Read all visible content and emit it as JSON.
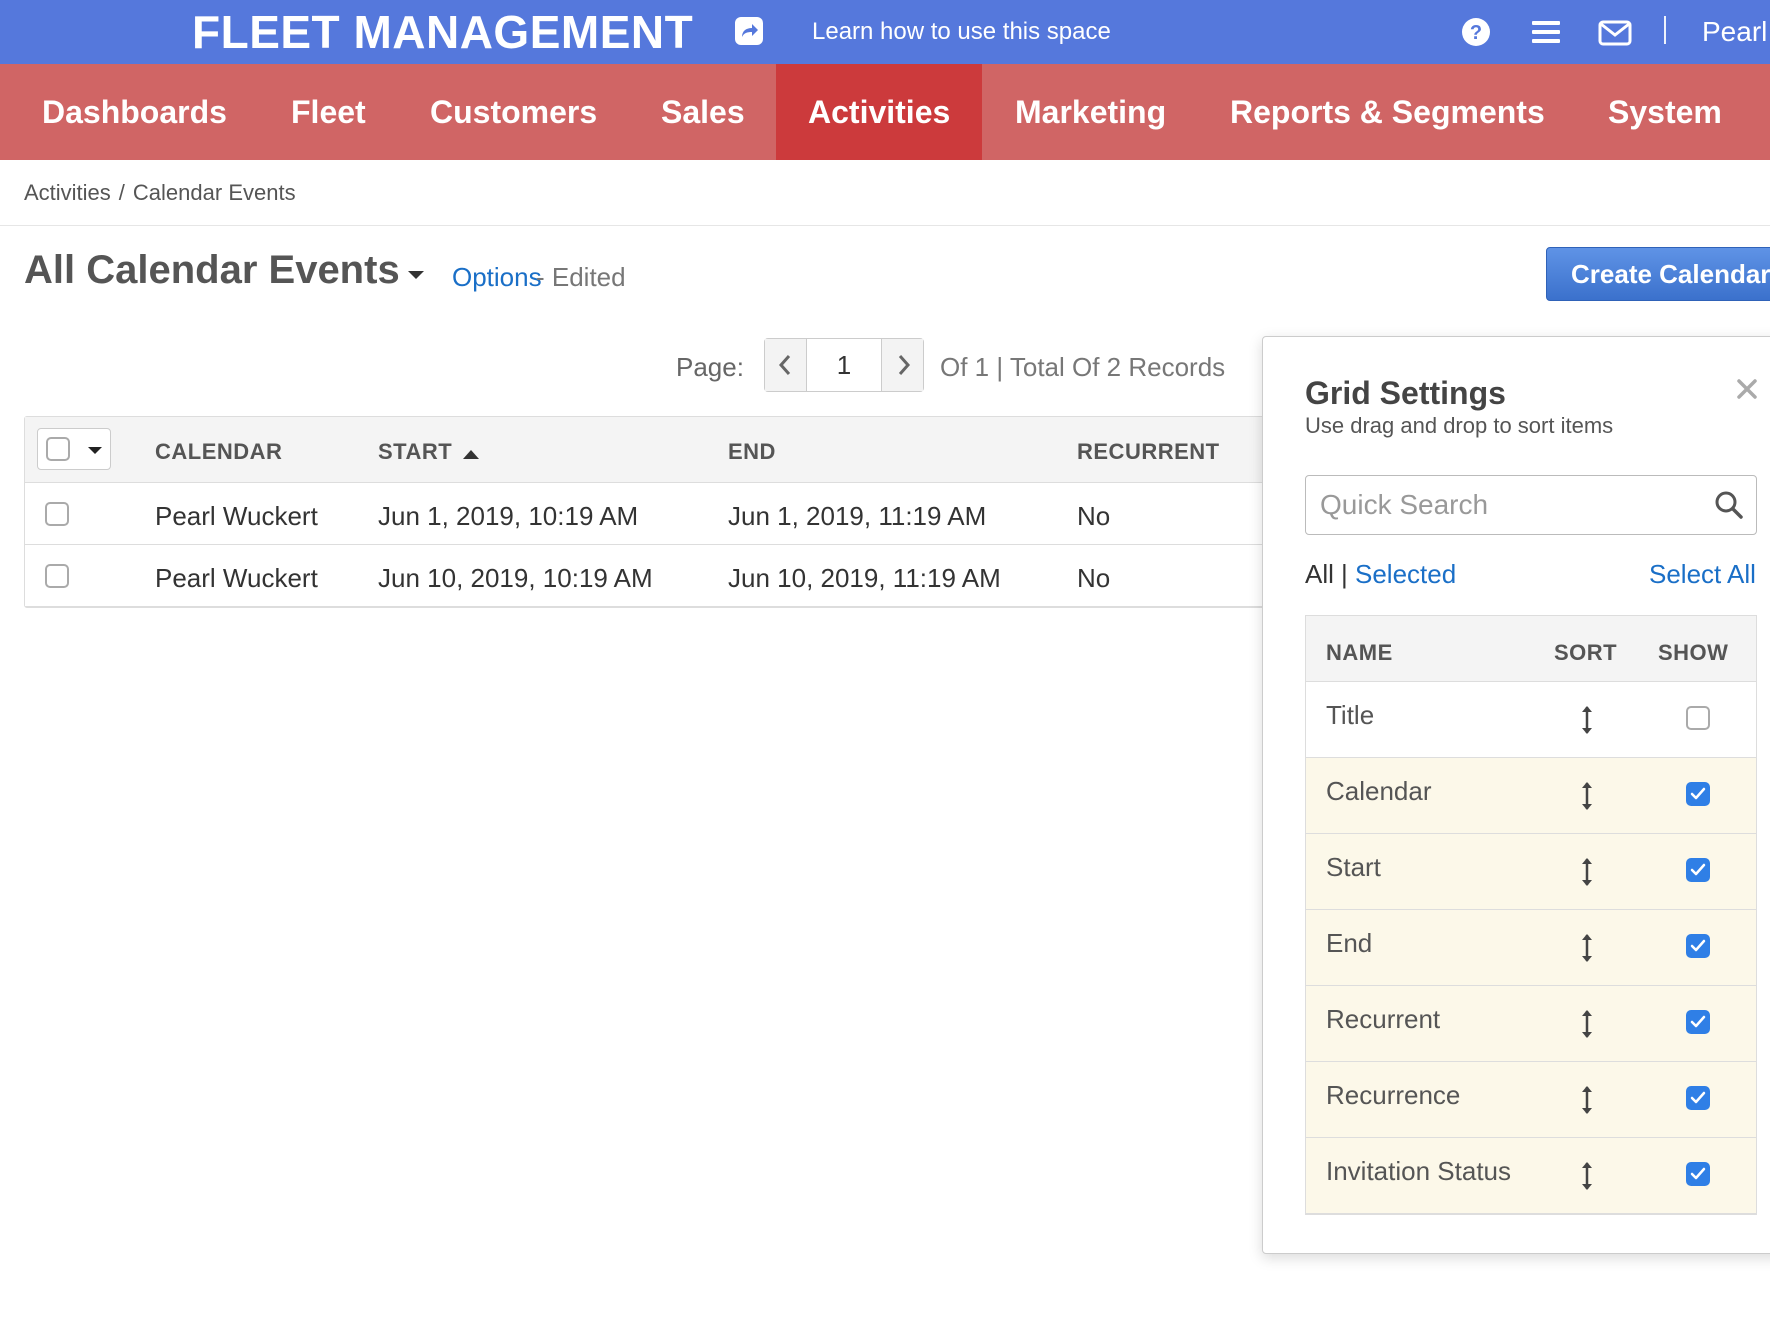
{
  "app": {
    "brand": "FLEET MANAGEMENT",
    "learn": "Learn how to use this space",
    "user": "Pearl",
    "icons": [
      "share-icon",
      "help-icon",
      "menu-icon",
      "mail-icon"
    ]
  },
  "nav": {
    "items": [
      {
        "label": "Dashboards"
      },
      {
        "label": "Fleet"
      },
      {
        "label": "Customers"
      },
      {
        "label": "Sales"
      },
      {
        "label": "Activities"
      },
      {
        "label": "Marketing"
      },
      {
        "label": "Reports & Segments"
      },
      {
        "label": "System"
      }
    ],
    "active": "Activities",
    "colors": {
      "bar": "#d06565",
      "active": "#cc3a3c",
      "top": "#5578dc"
    }
  },
  "breadcrumb": {
    "items": [
      "Activities",
      "Calendar Events"
    ],
    "separator": "/"
  },
  "page": {
    "title": "All Calendar Events",
    "options": "Options",
    "edited": "- Edited",
    "create_button": "Create Calendar"
  },
  "pager": {
    "label": "Page:",
    "current": "1",
    "info": "Of 1 | Total Of 2 Records"
  },
  "grid": {
    "columns": [
      "CALENDAR",
      "START",
      "END",
      "RECURRENT"
    ],
    "sorted_column": "START",
    "sort_direction": "ascending",
    "rows": [
      {
        "calendar": "Pearl Wuckert",
        "start": "Jun 1, 2019, 10:19 AM",
        "end": "Jun 1, 2019, 11:19 AM",
        "recurrent": "No"
      },
      {
        "calendar": "Pearl Wuckert",
        "start": "Jun 10, 2019, 10:19 AM",
        "end": "Jun 10, 2019, 11:19 AM",
        "recurrent": "No"
      }
    ]
  },
  "settings": {
    "title": "Grid Settings",
    "subtitle": "Use drag and drop to sort items",
    "search_placeholder": "Quick Search",
    "filter_all": "All",
    "filter_sep": "|",
    "filter_selected": "Selected",
    "select_all": "Select All",
    "headers": {
      "name": "NAME",
      "sort": "SORT",
      "show": "SHOW"
    },
    "columns": [
      {
        "name": "Title",
        "show": false
      },
      {
        "name": "Calendar",
        "show": true
      },
      {
        "name": "Start",
        "show": true
      },
      {
        "name": "End",
        "show": true
      },
      {
        "name": "Recurrent",
        "show": true
      },
      {
        "name": "Recurrence",
        "show": true
      },
      {
        "name": "Invitation Status",
        "show": true
      }
    ]
  }
}
